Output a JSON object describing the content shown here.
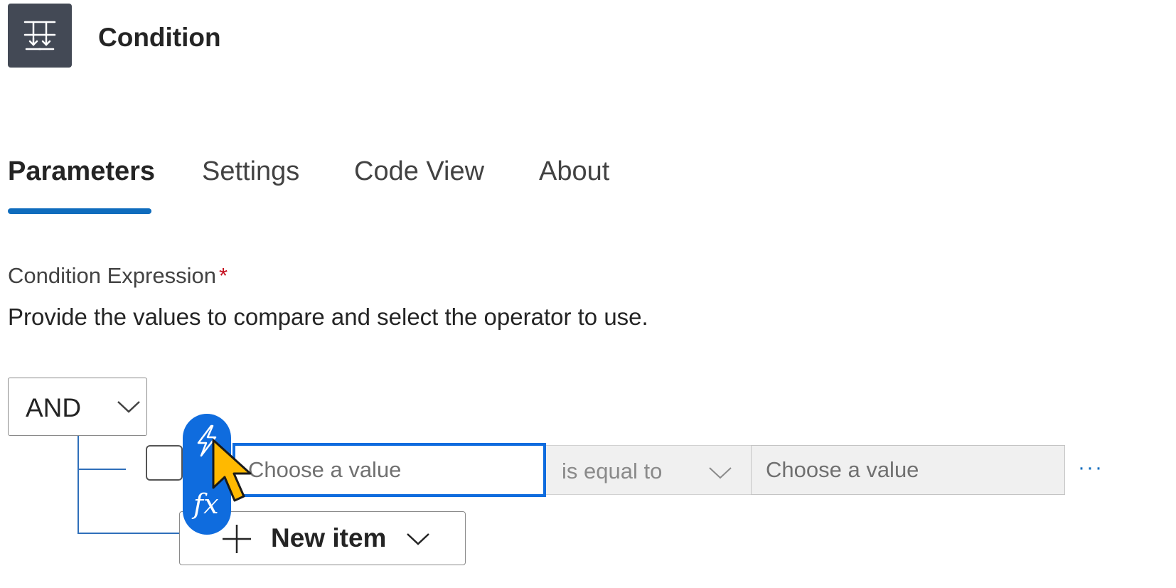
{
  "header": {
    "title": "Condition",
    "icon": "condition-icon",
    "icon_bg": "#434955"
  },
  "tabs": [
    {
      "label": "Parameters",
      "active": true
    },
    {
      "label": "Settings",
      "active": false
    },
    {
      "label": "Code View",
      "active": false
    },
    {
      "label": "About",
      "active": false
    }
  ],
  "field": {
    "label": "Condition Expression",
    "required_marker": "*",
    "description": "Provide the values to compare and select the operator to use."
  },
  "group": {
    "logic_operator": "AND",
    "row": {
      "left_placeholder": "Choose a value",
      "operator": "is equal to",
      "right_placeholder": "Choose a value",
      "more_label": "···"
    },
    "new_item_label": "New item"
  },
  "token_picker": {
    "dynamic_content_icon": "lightning-icon",
    "expression_label": "fx"
  },
  "colors": {
    "accent": "#0f6cbd",
    "focus": "#0f6cde",
    "required": "#c50f1f",
    "cursor": "#ffb900"
  }
}
